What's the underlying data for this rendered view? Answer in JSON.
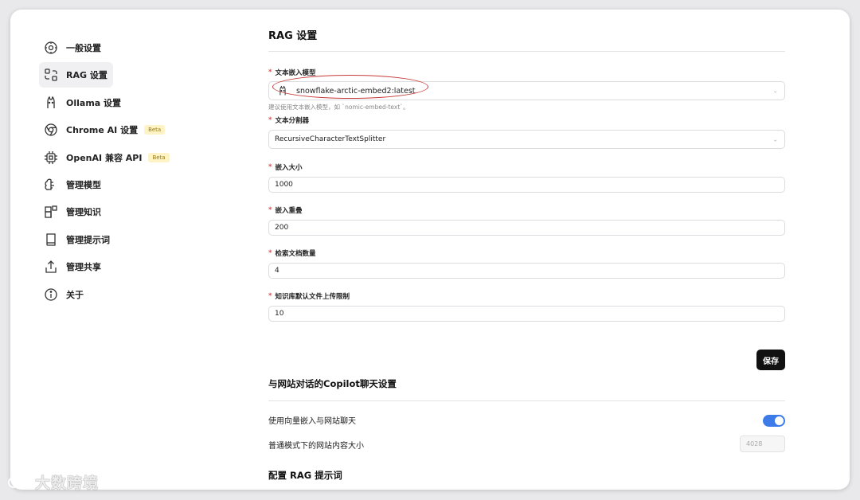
{
  "sidebar": {
    "items": [
      {
        "label": "一般设置",
        "icon": "gear-icon"
      },
      {
        "label": "RAG 设置",
        "icon": "rag-icon"
      },
      {
        "label": "Ollama 设置",
        "icon": "ollama-icon"
      },
      {
        "label": "Chrome AI 设置",
        "icon": "chrome-icon",
        "badge": "Beta"
      },
      {
        "label": "OpenAI 兼容 API",
        "icon": "chip-icon",
        "badge": "Beta"
      },
      {
        "label": "管理模型",
        "icon": "brain-icon"
      },
      {
        "label": "管理知识",
        "icon": "blocks-icon"
      },
      {
        "label": "管理提示词",
        "icon": "book-icon"
      },
      {
        "label": "管理共享",
        "icon": "share-icon"
      },
      {
        "label": "关于",
        "icon": "info-icon"
      }
    ],
    "active_index": 1
  },
  "main": {
    "title": "RAG 设置",
    "embedding_model": {
      "label": "文本嵌入模型",
      "value": "snowflake-arctic-embed2:latest",
      "hint": "建议使用文本嵌入模型，如 `nomic-embed-text`。"
    },
    "splitter": {
      "label": "文本分割器",
      "value": "RecursiveCharacterTextSplitter"
    },
    "chunk_size": {
      "label": "嵌入大小",
      "value": "1000"
    },
    "chunk_overlap": {
      "label": "嵌入重叠",
      "value": "200"
    },
    "doc_count": {
      "label": "检索文档数量",
      "value": "4"
    },
    "upload_limit": {
      "label": "知识库默认文件上传限制",
      "value": "10"
    },
    "save_label": "保存",
    "copilot_title": "与网站对话的Copilot聊天设置",
    "vector_chat_label": "使用向量嵌入与网站聊天",
    "vector_chat_enabled": true,
    "content_size_label": "普通模式下的网站内容大小",
    "content_size_value": "4028",
    "rag_prompt_title": "配置 RAG 提示词"
  },
  "watermark": "大数跨境",
  "colors": {
    "accent": "#3d7be8",
    "required": "#e24c4c",
    "annotation": "#c73a3a"
  }
}
